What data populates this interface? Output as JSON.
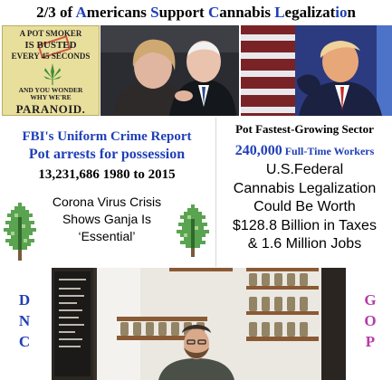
{
  "headline": {
    "parts": [
      {
        "text": "2/3 of ",
        "caps": false
      },
      {
        "text": "A",
        "caps": true
      },
      {
        "text": "merican",
        "caps": false
      },
      {
        "text": "s ",
        "caps": false
      },
      {
        "text": "S",
        "caps": true
      },
      {
        "text": "upport ",
        "caps": false
      },
      {
        "text": "C",
        "caps": true
      },
      {
        "text": "annabis ",
        "caps": false
      },
      {
        "text": "L",
        "caps": true
      },
      {
        "text": "egalizat",
        "caps": false
      },
      {
        "text": "io",
        "caps": true
      },
      {
        "text": "n",
        "caps": false
      }
    ]
  },
  "poster": {
    "line1": "A POT SMOKER",
    "line2": "IS BUSTED",
    "line3": "EVERY 45 SECONDS",
    "line4": "AND YOU WONDER",
    "line5": "WHY WE'RE",
    "line6": "PARANOID."
  },
  "left_panel": {
    "fbi": "FBI's Uniform Crime Report",
    "arrests": "Pot arrests for possession",
    "count": "13,231,686 1980 to 2015",
    "corona_lines": [
      "Corona Virus Crisis",
      "Shows Ganja Is",
      "‘Essential’"
    ]
  },
  "right_panel": {
    "sector": "Pot Fastest-Growing Sector",
    "workers_number": "240,000",
    "workers_label": " Full-Time Workers",
    "federal_lines": [
      "U.S.Federal",
      "Cannabis Legalization",
      "Could Be Worth",
      "$128.8 Billion in Taxes",
      "& 1.6 Million Jobs"
    ]
  },
  "sides": {
    "dnc": [
      "D",
      "N",
      "C"
    ],
    "gop": [
      "G",
      "O",
      "P"
    ]
  },
  "colors": {
    "blue": "#1f3fb8",
    "magenta": "#b53ba8",
    "leaf_green": "#3f8f3a"
  }
}
